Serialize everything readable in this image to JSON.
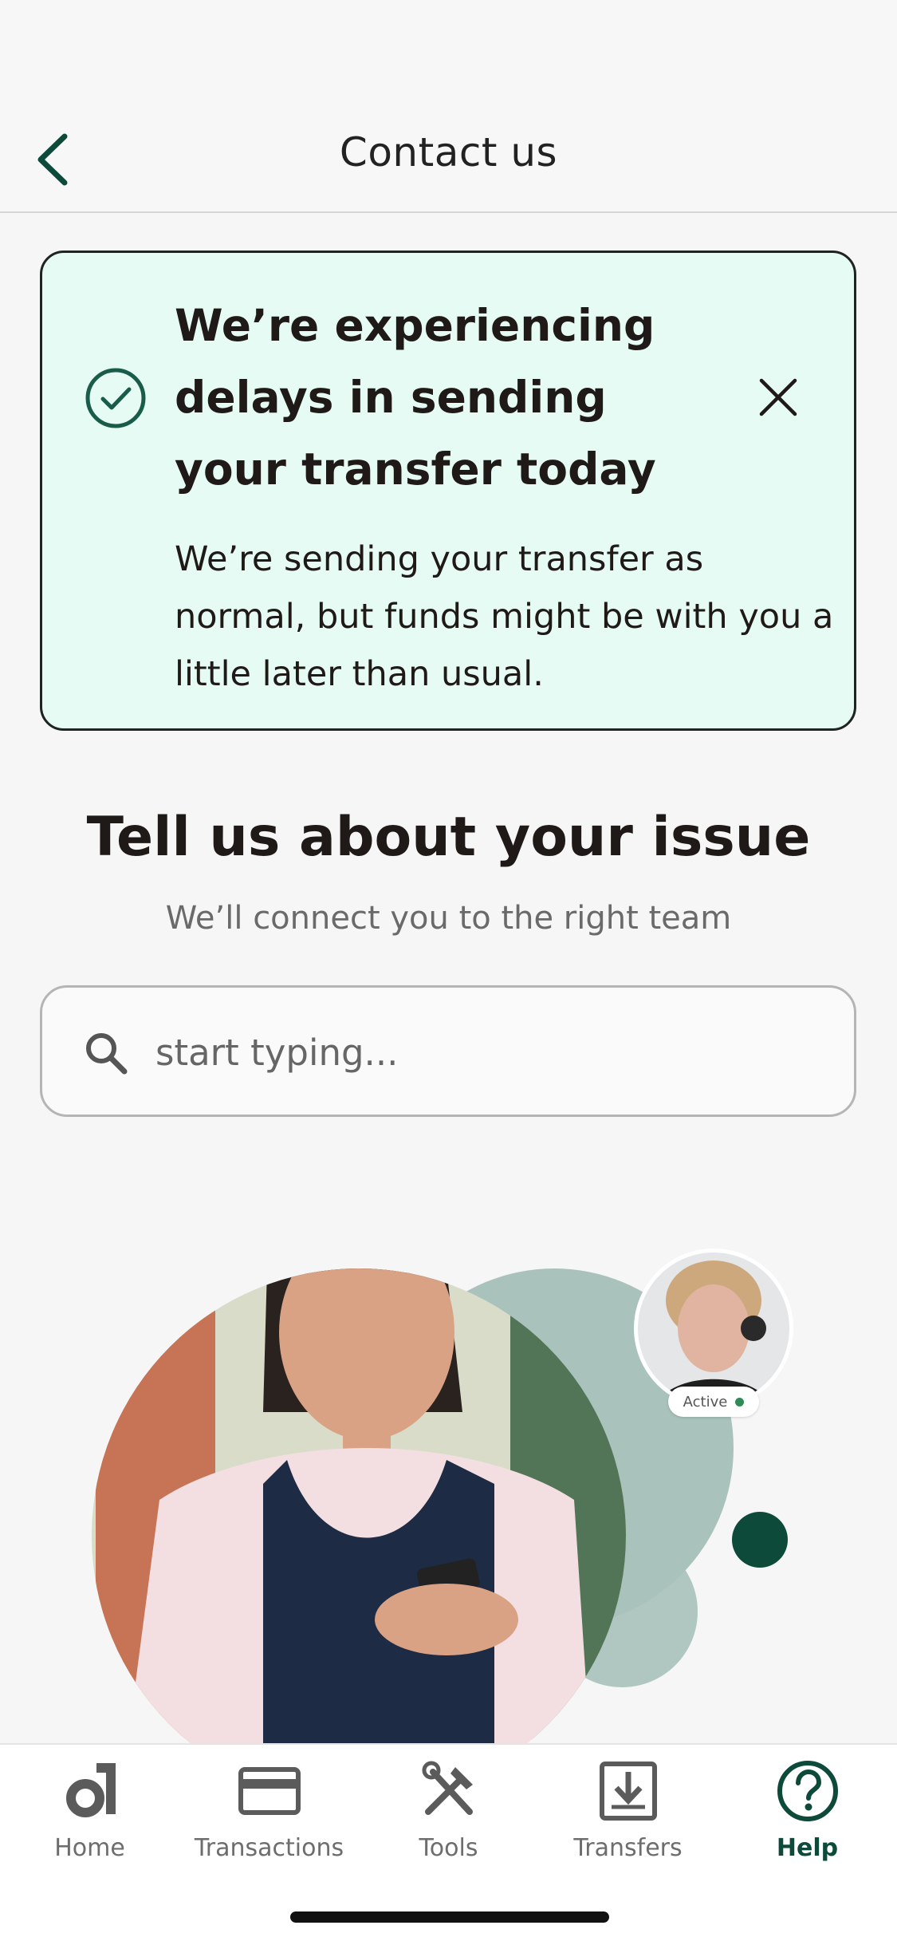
{
  "header": {
    "title": "Contact us",
    "back_icon": "chevron-left-icon"
  },
  "banner": {
    "title": "We’re experiencing delays in sending your transfer today",
    "body": "We’re sending your transfer as normal, but funds might be with you a little later than usual.",
    "status_icon": "check-circle-icon",
    "close_icon": "close-icon",
    "background_color": "#e6fbf4"
  },
  "issue": {
    "title": "Tell us about your issue",
    "subtitle": "We’ll connect you to the right team"
  },
  "search": {
    "placeholder": "start typing...",
    "value": ""
  },
  "agent": {
    "status": "Active"
  },
  "tabs": [
    {
      "label": "Home",
      "icon": "home-logo-icon",
      "active": false
    },
    {
      "label": "Transactions",
      "icon": "card-icon",
      "active": false
    },
    {
      "label": "Tools",
      "icon": "tools-icon",
      "active": false
    },
    {
      "label": "Transfers",
      "icon": "download-tray-icon",
      "active": false
    },
    {
      "label": "Help",
      "icon": "help-circle-icon",
      "active": true
    }
  ],
  "colors": {
    "brand_dark_green": "#0e4a3a",
    "accent_sage": "#a9c2bb"
  }
}
